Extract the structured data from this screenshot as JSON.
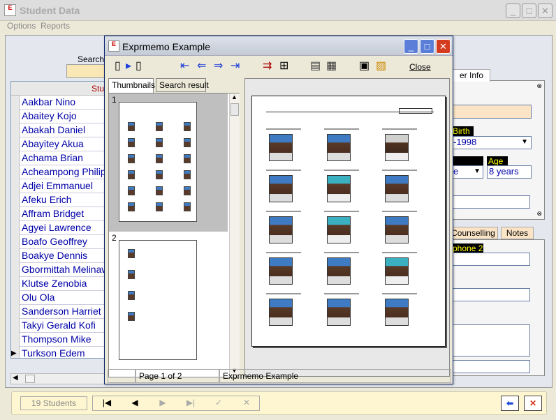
{
  "app": {
    "title": "Student Data",
    "icon_label": "E",
    "min": "_",
    "max": "□",
    "close": "✕"
  },
  "menu": [
    "Options",
    "Reports"
  ],
  "search": {
    "label": "Search"
  },
  "grid": {
    "header_partial": "Stud",
    "rows": [
      "Aakbar Nino",
      "Abaitey Kojo",
      "Abakah Daniel",
      "Abayitey Akua",
      "Achama Brian",
      "Acheampong Philip",
      "Adjei Emmanuel",
      "Afeku Erich",
      "Affram Bridget",
      "Agyei Lawrence",
      "Boafo Geoffrey",
      "Boakye Dennis",
      "Gbormittah Melinaw",
      "Klutse Zenobia",
      "Olu Ola",
      "Sanderson Harriet",
      "Takyi Gerald Kofi",
      "Thompson Mike",
      "Turkson Edem"
    ],
    "current_index": 18
  },
  "right_form": {
    "tab_partial": "er Info",
    "birth_label": "Birth",
    "birth_value": "-1998",
    "age_label": "Age",
    "age_value": "8 years",
    "gender_partial": "e",
    "tabs": [
      "Counselling",
      "Notes"
    ],
    "phone_label": "phone 2"
  },
  "bottom": {
    "count": "19 Students",
    "nav": [
      "|◀",
      "◀",
      "▶",
      "▶|",
      "✓",
      "✕"
    ]
  },
  "dialog": {
    "title": "Exprmemo Example",
    "icon_label": "E",
    "close_label": "Close",
    "tabs": [
      "Thumbnails",
      "Search result"
    ],
    "page_labels": [
      "1",
      "2"
    ],
    "status": {
      "page": "Page 1 of 2",
      "name": "Exprmemo Example"
    }
  },
  "colors": {
    "accent": "#0000a8",
    "search_bg": "#f9e7b5",
    "close_red": "#d43b1f"
  }
}
